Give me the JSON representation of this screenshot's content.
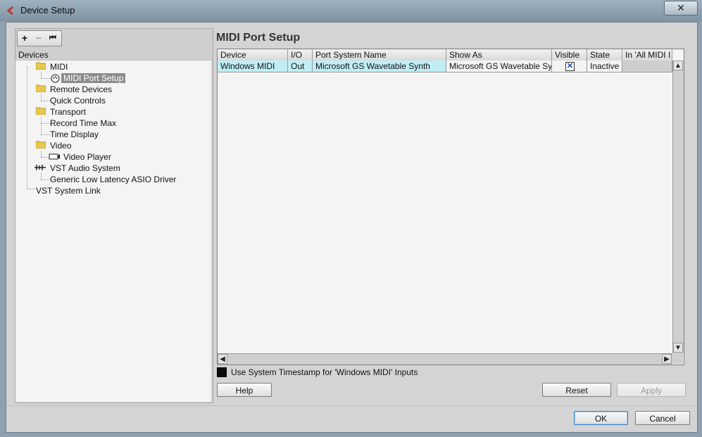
{
  "window": {
    "title": "Device Setup",
    "close_glyph": "✕"
  },
  "toolbar": {
    "add": "+",
    "remove": "−",
    "reset": "⏮"
  },
  "left": {
    "devices_label": "Devices",
    "tree": [
      {
        "label": "MIDI",
        "icon": "folder-icon"
      },
      {
        "label": "MIDI Port Setup",
        "icon": "midi-port-icon",
        "selected": true
      },
      {
        "label": "Remote Devices",
        "icon": "folder-icon"
      },
      {
        "label": "Quick Controls",
        "icon": ""
      },
      {
        "label": "Transport",
        "icon": "folder-icon"
      },
      {
        "label": "Record Time Max",
        "icon": ""
      },
      {
        "label": "Time Display",
        "icon": ""
      },
      {
        "label": "Video",
        "icon": "folder-icon"
      },
      {
        "label": "Video Player",
        "icon": "video-player-icon"
      },
      {
        "label": "VST Audio System",
        "icon": "vst-audio-icon"
      },
      {
        "label": "Generic Low Latency ASIO Driver",
        "icon": ""
      },
      {
        "label": "VST System Link",
        "icon": ""
      }
    ]
  },
  "right": {
    "title": "MIDI Port Setup",
    "columns": [
      "Device",
      "I/O",
      "Port System Name",
      "Show As",
      "Visible",
      "State",
      "In 'All MIDI I"
    ],
    "rows": [
      {
        "device": "Windows MIDI",
        "io": "Out",
        "port": "Microsoft GS Wavetable Synth",
        "show_as": "Microsoft GS Wavetable Synth",
        "visible": "✕",
        "state": "Inactive",
        "in_all": ""
      }
    ],
    "timestamp_label": "Use System Timestamp for 'Windows MIDI' Inputs"
  },
  "buttons": {
    "help": "Help",
    "reset": "Reset",
    "apply": "Apply",
    "ok": "OK",
    "cancel": "Cancel"
  },
  "colors": {
    "selection_row": "#bfeef5",
    "tree_selected": "#8b8b8b",
    "accent": "#3f82c5"
  }
}
